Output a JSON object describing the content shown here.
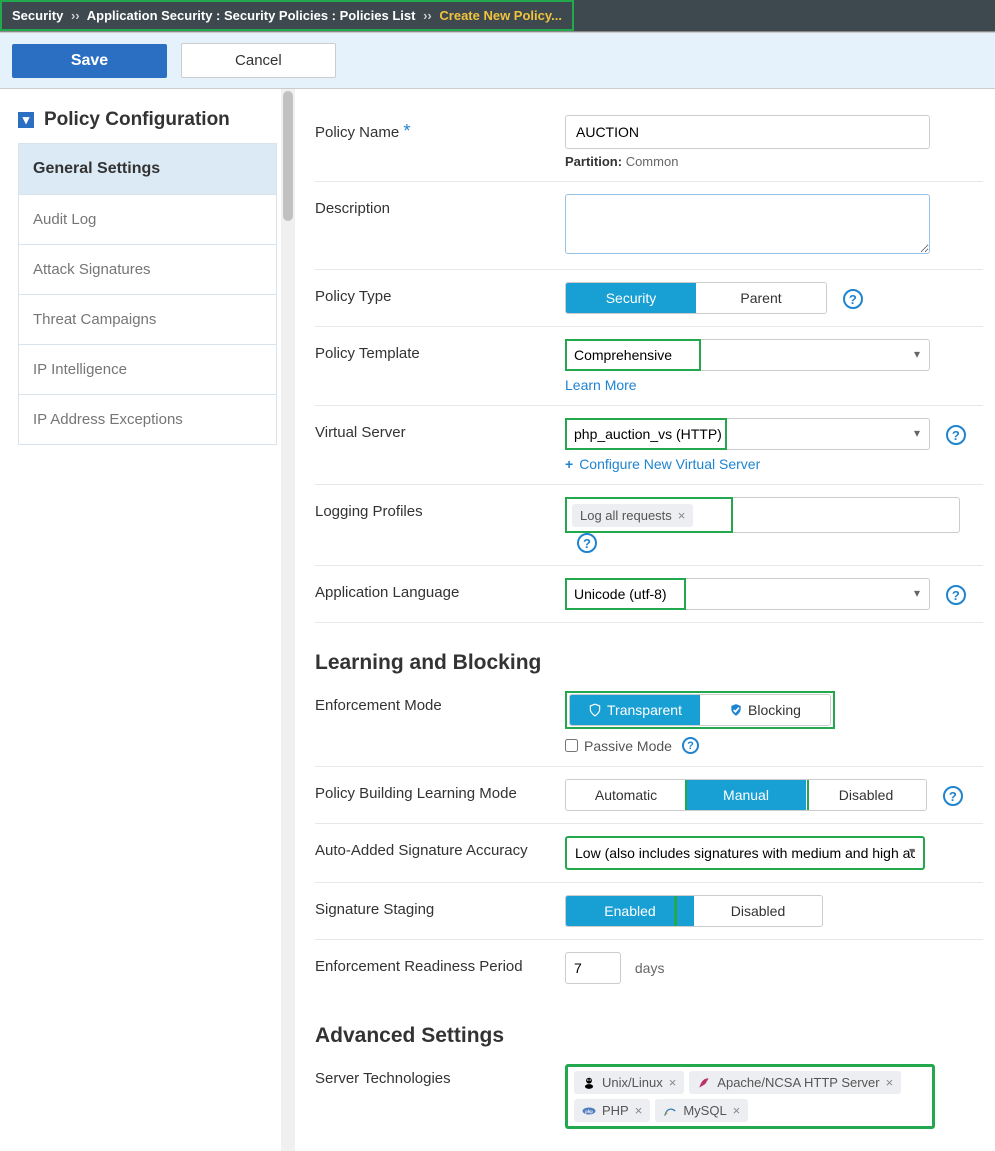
{
  "breadcrumb": {
    "root": "Security",
    "path": "Application Security : Security Policies : Policies List",
    "current": "Create New Policy..."
  },
  "toolbar": {
    "save": "Save",
    "cancel": "Cancel"
  },
  "sidebar": {
    "title": "Policy Configuration",
    "items": [
      {
        "label": "General Settings",
        "active": true
      },
      {
        "label": "Audit Log"
      },
      {
        "label": "Attack Signatures"
      },
      {
        "label": "Threat Campaigns"
      },
      {
        "label": "IP Intelligence"
      },
      {
        "label": "IP Address Exceptions"
      }
    ]
  },
  "fields": {
    "policy_name": {
      "label": "Policy Name",
      "value": "AUCTION",
      "partition_label": "Partition:",
      "partition_value": "Common"
    },
    "description": {
      "label": "Description",
      "value": ""
    },
    "policy_type": {
      "label": "Policy Type",
      "options": {
        "security": "Security",
        "parent": "Parent"
      }
    },
    "policy_template": {
      "label": "Policy Template",
      "value": "Comprehensive",
      "learn_more": "Learn More"
    },
    "virtual_server": {
      "label": "Virtual Server",
      "value": "php_auction_vs (HTTP)",
      "configure": "Configure New Virtual Server"
    },
    "logging_profiles": {
      "label": "Logging Profiles",
      "tags": [
        "Log all requests"
      ]
    },
    "app_language": {
      "label": "Application Language",
      "value": "Unicode (utf-8)"
    }
  },
  "learning": {
    "heading": "Learning and Blocking",
    "enforcement_mode": {
      "label": "Enforcement Mode",
      "transparent": "Transparent",
      "blocking": "Blocking",
      "passive": "Passive Mode"
    },
    "learning_mode": {
      "label": "Policy Building Learning Mode",
      "automatic": "Automatic",
      "manual": "Manual",
      "disabled": "Disabled"
    },
    "sig_accuracy": {
      "label": "Auto-Added Signature Accuracy",
      "value": "Low (also includes signatures with medium and high accuracy)"
    },
    "sig_staging": {
      "label": "Signature Staging",
      "enabled": "Enabled",
      "disabled": "Disabled"
    },
    "readiness": {
      "label": "Enforcement Readiness Period",
      "value": "7",
      "unit": "days"
    }
  },
  "advanced": {
    "heading": "Advanced Settings",
    "server_tech": {
      "label": "Server Technologies",
      "tags": [
        "Unix/Linux",
        "Apache/NCSA HTTP Server",
        "PHP",
        "MySQL"
      ]
    }
  },
  "icons": {
    "help": "?",
    "close": "×",
    "plus": "+"
  }
}
